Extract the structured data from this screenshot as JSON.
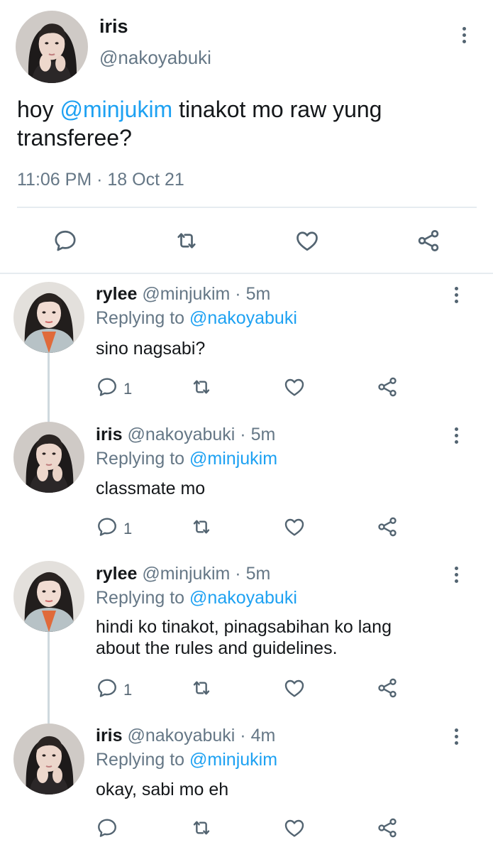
{
  "main_tweet": {
    "display_name": "iris",
    "handle": "@nakoyabuki",
    "text_prefix": "hoy ",
    "mention": "@minjukim",
    "text_suffix": " tinakot mo raw yung transferee?",
    "timestamp": "11:06 PM · 18 Oct 21",
    "avatar": "avatar-iris",
    "actions": [
      "reply-icon",
      "retweet-icon",
      "like-icon",
      "share-icon"
    ]
  },
  "replies": [
    {
      "display_name": "rylee",
      "handle": "@minjukim",
      "time": "5m",
      "replying_prefix": "Replying to ",
      "replying_to": "@nakoyabuki",
      "text": "sino nagsabi?",
      "reply_count": "1",
      "avatar": "avatar-rylee"
    },
    {
      "display_name": "iris",
      "handle": "@nakoyabuki",
      "time": "5m",
      "replying_prefix": "Replying to ",
      "replying_to": "@minjukim",
      "text": "classmate mo",
      "reply_count": "1",
      "avatar": "avatar-iris"
    },
    {
      "display_name": "rylee",
      "handle": "@minjukim",
      "time": "5m",
      "replying_prefix": "Replying to ",
      "replying_to": "@nakoyabuki",
      "text_line1": "hindi ko tinakot, pinagsabihan ko lang",
      "text_line2": "about the rules and guidelines.",
      "reply_count": "1",
      "avatar": "avatar-rylee"
    },
    {
      "display_name": "iris",
      "handle": "@nakoyabuki",
      "time": "4m",
      "replying_prefix": "Replying to ",
      "replying_to": "@minjukim",
      "text": "okay, sabi mo eh",
      "reply_count": "",
      "avatar": "avatar-iris"
    }
  ],
  "colors": {
    "link": "#1da1f2",
    "secondary_text": "#657786",
    "icon": "#536471",
    "divider": "#e6ecf0",
    "thread_line": "#cfd9de"
  }
}
